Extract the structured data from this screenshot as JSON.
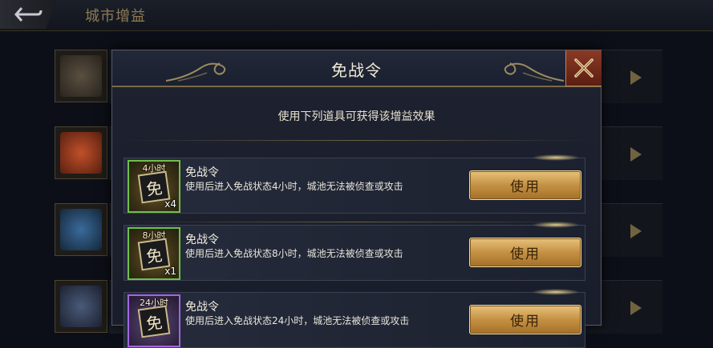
{
  "header": {
    "title": "城市增益",
    "back_icon": "back-arrow-icon"
  },
  "dialog": {
    "title": "免战令",
    "subtitle": "使用下列道具可获得该增益效果",
    "close_icon": "close-x-icon",
    "items": [
      {
        "duration": "4小时",
        "quantity": "x4",
        "emblem": "免",
        "name": "免战令",
        "description": "使用后进入免战状态4小时，城池无法被侦查或攻击",
        "button": "使用",
        "rarity_color": "#6fbf4a"
      },
      {
        "duration": "8小时",
        "quantity": "x1",
        "emblem": "免",
        "name": "免战令",
        "description": "使用后进入免战状态8小时，城池无法被侦查或攻击",
        "button": "使用",
        "rarity_color": "#6fbf4a"
      },
      {
        "duration": "24小时",
        "quantity": "",
        "emblem": "免",
        "name": "免战令",
        "description": "使用后进入免战状态24小时，城池无法被侦查或攻击",
        "button": "使用",
        "rarity_color": "#a266e0"
      }
    ]
  },
  "colors": {
    "accent_gold": "#c49144",
    "title_text": "#f1ead8",
    "close_red": "#8a3a26"
  }
}
